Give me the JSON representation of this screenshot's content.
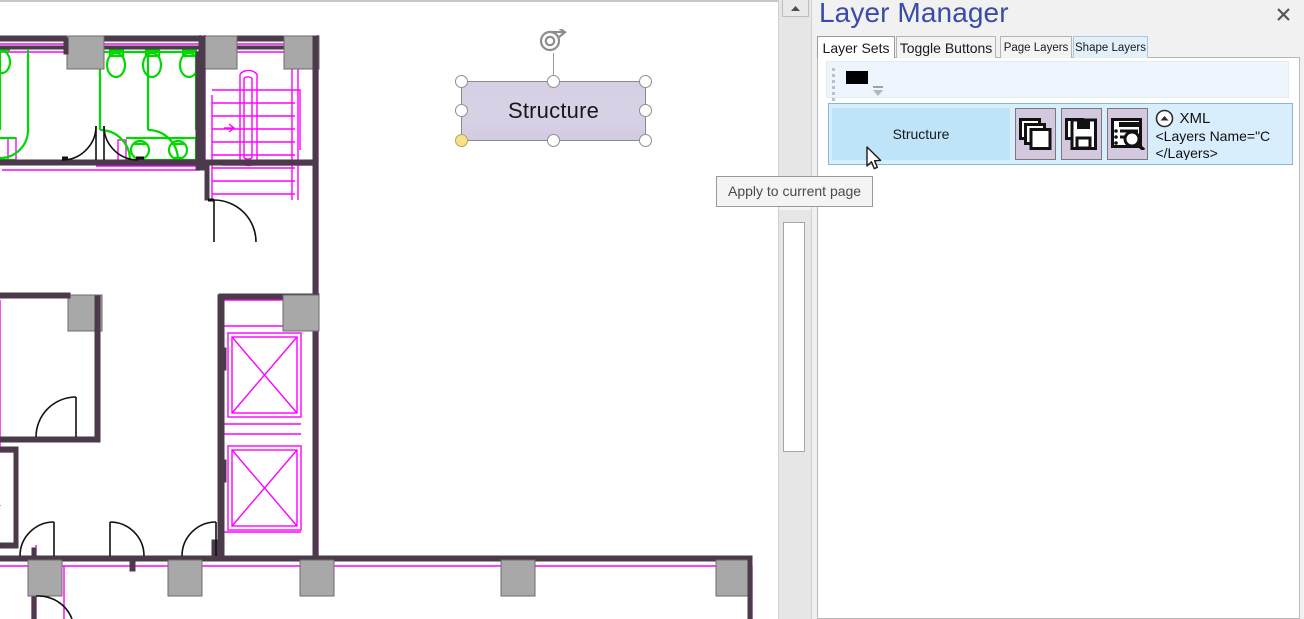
{
  "window": {
    "canvas_top_rule": true
  },
  "shape": {
    "label": "Structure",
    "fill_color": "#d6cee4",
    "handle_color": "#ffffff",
    "special_handle_color": "#f7e08a",
    "rotate_icon": "rotate-icon"
  },
  "tooltip": {
    "text": "Apply to current page"
  },
  "scrollbar": {
    "up_arrow_icon": "scroll-up-arrow-icon",
    "orientation": "vertical"
  },
  "panel": {
    "title": "Layer Manager",
    "title_color": "#3b4ba8",
    "close_icon": "close-icon",
    "close_label": "×",
    "tabs": [
      {
        "label": "Layer Sets",
        "active": true,
        "style": "active"
      },
      {
        "label": "Toggle Buttons",
        "active": false,
        "style": "plain"
      },
      {
        "label": "Page Layers",
        "active": false,
        "style": "plain"
      },
      {
        "label": "Shape Layers",
        "active": false,
        "style": "lightblue"
      }
    ],
    "toolbar": {
      "drag_handle_icon": "drag-dots-icon",
      "color_swatch_value": "#000000",
      "dropdown_icon": "chevron-down-icon"
    },
    "layer_set": {
      "name": "Structure",
      "row_background": "#bfe4f8",
      "buttons": [
        {
          "name": "duplicate-layers-button",
          "icon": "layers-copy-icon"
        },
        {
          "name": "save-layers-button",
          "icon": "save-icon"
        },
        {
          "name": "inspect-layers-button",
          "icon": "list-search-icon"
        }
      ],
      "xml": {
        "collapse_icon": "chevron-up-circle-icon",
        "label": "XML",
        "lines": [
          "<Layers Name=\"C",
          "</Layers>"
        ]
      }
    }
  },
  "cursor": {
    "icon": "mouse-pointer-icon"
  },
  "floorplan": {
    "description": "Architectural floor plan with restrooms, stairs and elevators",
    "wall_color": "#4a3a4a",
    "fixture_color": "#00d900",
    "stair_color": "#ff00ff",
    "column_fill": "#a8a8a8"
  }
}
